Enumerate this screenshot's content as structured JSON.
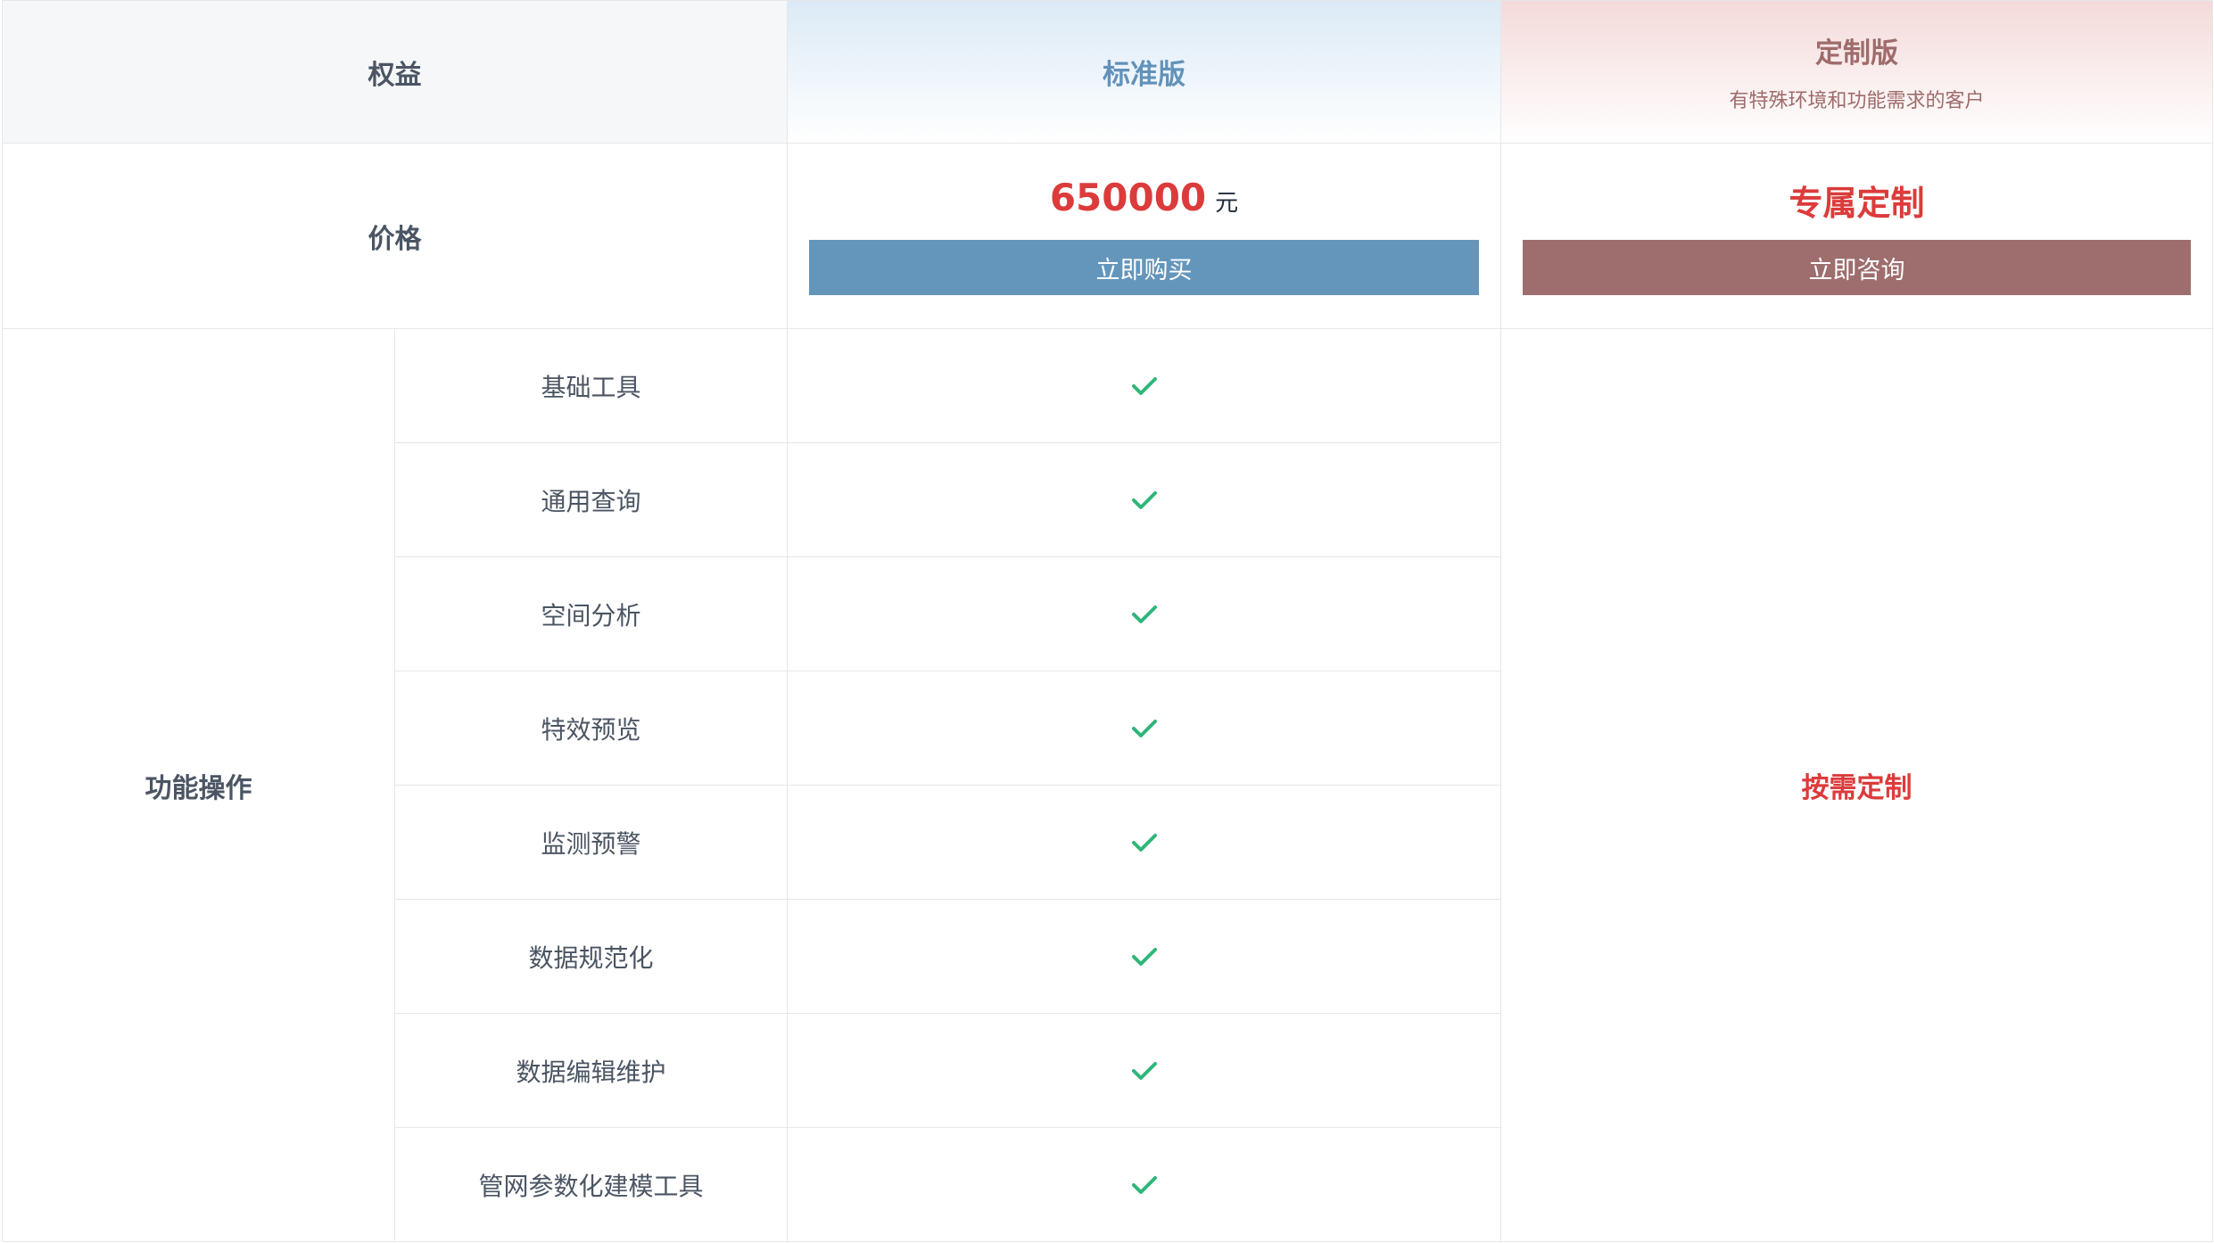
{
  "header": {
    "rights_label": "权益",
    "standard_title": "标准版",
    "custom_title": "定制版",
    "custom_subtitle": "有特殊环境和功能需求的客户"
  },
  "price": {
    "label": "价格",
    "standard_amount": "650000",
    "standard_unit": "元",
    "standard_button": "立即购买",
    "custom_text": "专属定制",
    "custom_button": "立即咨询"
  },
  "features": {
    "group_label": "功能操作",
    "custom_note": "按需定制",
    "items": [
      {
        "name": "基础工具",
        "standard": "check-icon"
      },
      {
        "name": "通用查询",
        "standard": "check-icon"
      },
      {
        "name": "空间分析",
        "standard": "check-icon"
      },
      {
        "name": "特效预览",
        "standard": "check-icon"
      },
      {
        "name": "监测预警",
        "standard": "check-icon"
      },
      {
        "name": "数据规范化",
        "standard": "check-icon"
      },
      {
        "name": "数据编辑维护",
        "standard": "check-icon"
      },
      {
        "name": "管网参数化建模工具",
        "standard": "check-icon"
      }
    ]
  },
  "colors": {
    "standard_accent": "#6496bb",
    "custom_accent": "#9e6e6e",
    "price_red": "#dc3b3b",
    "check_green": "#2fb67a"
  }
}
